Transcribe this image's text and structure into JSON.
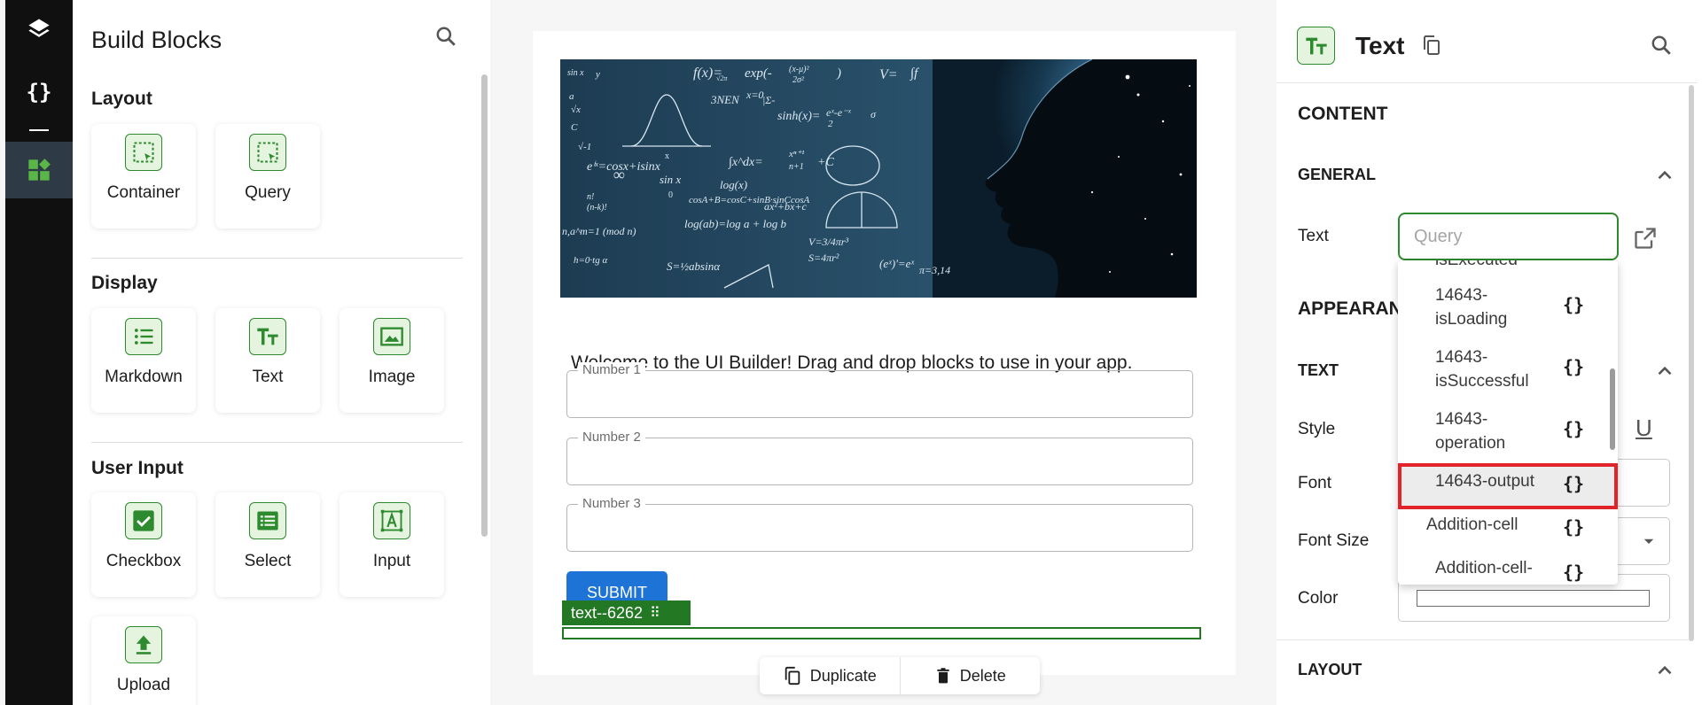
{
  "rail": {
    "items": [
      {
        "icon": "layers-icon"
      },
      {
        "icon": "braces-icon",
        "label": "{}"
      },
      {
        "icon": "blocks-icon"
      }
    ]
  },
  "blocks_panel": {
    "title": "Build Blocks",
    "sections": [
      {
        "title": "Layout",
        "items": [
          {
            "label": "Container",
            "icon": "container-icon"
          },
          {
            "label": "Query",
            "icon": "query-icon"
          }
        ]
      },
      {
        "title": "Display",
        "items": [
          {
            "label": "Markdown",
            "icon": "markdown-icon"
          },
          {
            "label": "Text",
            "icon": "text-icon"
          },
          {
            "label": "Image",
            "icon": "image-icon"
          }
        ]
      },
      {
        "title": "User Input",
        "items": [
          {
            "label": "Checkbox",
            "icon": "checkbox-icon"
          },
          {
            "label": "Select",
            "icon": "select-icon"
          },
          {
            "label": "Input",
            "icon": "input-icon"
          },
          {
            "label": "Upload",
            "icon": "upload-icon"
          }
        ]
      }
    ]
  },
  "canvas": {
    "welcome": "Welcome to the UI Builder! Drag and drop blocks to use in your app.",
    "fields": [
      {
        "label": "Number 1"
      },
      {
        "label": "Number 2"
      },
      {
        "label": "Number 3"
      }
    ],
    "submit_label": "SUBMIT",
    "selection_tag": "text--6262",
    "selection_tag_icon": "⠿",
    "actions": {
      "duplicate": "Duplicate",
      "delete": "Delete"
    },
    "hero_math": {
      "texts": [
        "sin x",
        "y",
        "f(x)=",
        "√2π",
        "exp(-",
        "(x-μ)²",
        "2σ²",
        ")",
        "V=",
        "∫f",
        "a",
        "√x",
        "sinh(x)=",
        "eˣ-e⁻ˣ",
        "2",
        "σ",
        "x=0",
        "3NEN",
        "|Σ-",
        "C",
        "√-1",
        "eⁱˣ=cosx+isinx",
        "∫x^dx=",
        "xⁿ⁺¹",
        "n+1",
        "+C",
        "sin x",
        "log(x)",
        "cosA+B=cosC+sinB·sinCcosA",
        "∞",
        "n!",
        "(n-k)!",
        "ax²+bx+c",
        "n,a^m=1 (mod n)",
        "log(ab)=log a + log b",
        "V=3/4πr³",
        "S=4πr²",
        "S=½absinα",
        "(eˣ)'=eˣ",
        "π=3,14",
        "h=0·tg α"
      ],
      "ticks": [
        "x",
        "0"
      ]
    }
  },
  "props": {
    "title": "Text",
    "content_caption": "CONTENT",
    "general_caption": "GENERAL",
    "text_label": "Text",
    "text_placeholder": "Query",
    "appearance_caption": "APPEARANCE",
    "text_caption": "TEXT",
    "style_label": "Style",
    "underline_label": "U",
    "font_label": "Font",
    "font_size_label": "Font Size",
    "color_label": "Color",
    "layout_caption": "LAYOUT",
    "dropdown": {
      "clipped_label": "isExecuted",
      "items": [
        {
          "line1": "14643-",
          "line2": "isLoading"
        },
        {
          "line1": "14643-",
          "line2": "isSuccessful"
        },
        {
          "line1": "14643-",
          "line2": "operation"
        },
        {
          "line1": "14643-output",
          "line2": ""
        },
        {
          "line1": "Addition-cell",
          "line2": ""
        },
        {
          "line1": "Addition-cell-",
          "line2": ""
        }
      ],
      "brace": "{}"
    }
  }
}
